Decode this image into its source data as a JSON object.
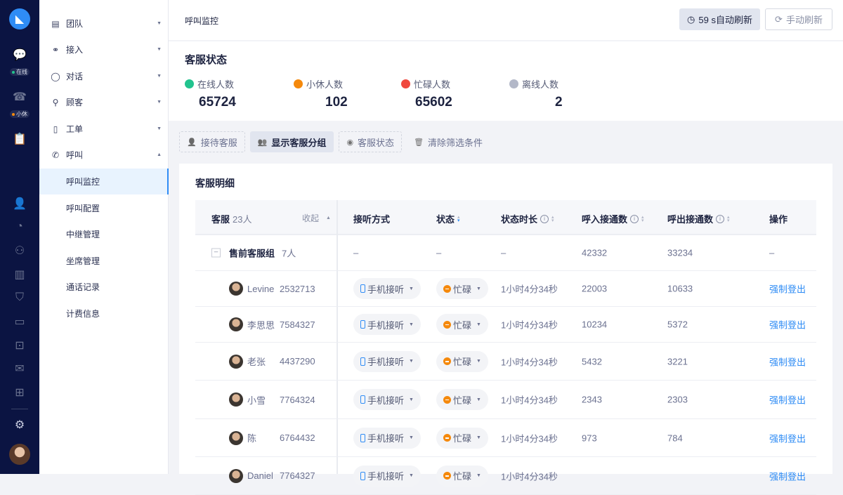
{
  "rail": {
    "status_online": "在线",
    "status_break": "小休",
    "online_color": "#22c38e",
    "break_color": "#f5890c"
  },
  "sidebar": {
    "items": [
      {
        "label": "团队",
        "icon": "report-icon"
      },
      {
        "label": "接入",
        "icon": "org-icon"
      },
      {
        "label": "对话",
        "icon": "chat-icon"
      },
      {
        "label": "顾客",
        "icon": "users-icon"
      },
      {
        "label": "工单",
        "icon": "ticket-icon"
      },
      {
        "label": "呼叫",
        "icon": "phone-icon"
      }
    ],
    "sub": [
      "呼叫监控",
      "呼叫配置",
      "中继管理",
      "坐席管理",
      "通话记录",
      "计费信息"
    ]
  },
  "header": {
    "breadcrumb": "呼叫监控",
    "auto_refresh": "59 s自动刷新",
    "manual_refresh": "手动刷新"
  },
  "stats": {
    "title": "客服状态",
    "items": [
      {
        "label": "在线人数",
        "value": "65724",
        "color": "#22c38e"
      },
      {
        "label": "小休人数",
        "value": "102",
        "color": "#f5890c"
      },
      {
        "label": "忙碌人数",
        "value": "65602",
        "color": "#f0483e"
      },
      {
        "label": "离线人数",
        "value": "2",
        "color": "#b3b8c8"
      }
    ]
  },
  "filters": [
    "接待客服",
    "显示客服分组",
    "客服状态",
    "清除筛选条件"
  ],
  "table": {
    "title": "客服明细",
    "headers": {
      "agent": "客服",
      "agent_count": "23人",
      "collapse": "收起",
      "answer": "接听方式",
      "status": "状态",
      "duration": "状态时长",
      "in": "呼入接通数",
      "out": "呼出接通数",
      "action": "操作"
    },
    "group": {
      "name": "售前客服组",
      "count": "7人",
      "answer": "–",
      "status": "–",
      "duration": "–",
      "in": "42332",
      "out": "33234",
      "action": "–"
    },
    "rows": [
      {
        "name": "Levine",
        "id": "2532713",
        "answer": "手机接听",
        "status": "忙碌",
        "duration": "1小时4分34秒",
        "in": "22003",
        "out": "10633",
        "action": "强制登出"
      },
      {
        "name": "李思思",
        "id": "7584327",
        "answer": "手机接听",
        "status": "忙碌",
        "duration": "1小时4分34秒",
        "in": "10234",
        "out": "5372",
        "action": "强制登出"
      },
      {
        "name": "老张",
        "id": "4437290",
        "answer": "手机接听",
        "status": "忙碌",
        "duration": "1小时4分34秒",
        "in": "5432",
        "out": "3221",
        "action": "强制登出"
      },
      {
        "name": "小雪",
        "id": "7764324",
        "answer": "手机接听",
        "status": "忙碌",
        "duration": "1小时4分34秒",
        "in": "2343",
        "out": "2303",
        "action": "强制登出"
      },
      {
        "name": "陈",
        "id": "6764432",
        "answer": "手机接听",
        "status": "忙碌",
        "duration": "1小时4分34秒",
        "in": "973",
        "out": "784",
        "action": "强制登出"
      },
      {
        "name": "Daniel",
        "id": "7764327",
        "answer": "手机接听",
        "status": "忙碌",
        "duration": "1小时4分34秒",
        "in": "",
        "out": "",
        "action": "强制登出"
      }
    ]
  }
}
